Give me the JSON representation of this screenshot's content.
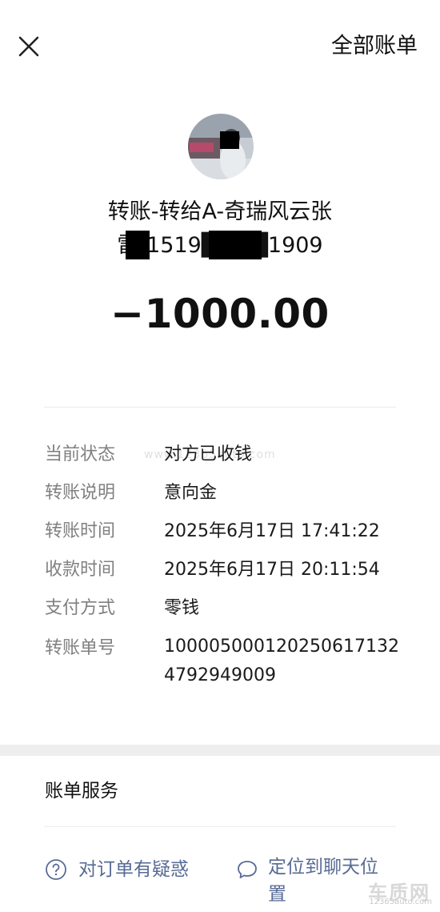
{
  "topbar": {
    "close_icon": "close-icon",
    "all_bills_label": "全部账单"
  },
  "header": {
    "avatar_icon": "avatar",
    "title_line1": "转账-转给A-奇瑞风云张",
    "title_line2": "雷-1519████1909",
    "amount": "−1000.00"
  },
  "details": [
    {
      "label": "当前状态",
      "value": "对方已收钱"
    },
    {
      "label": "转账说明",
      "value": "意向金"
    },
    {
      "label": "转账时间",
      "value": "2025年6月17日 17:41:22"
    },
    {
      "label": "收款时间",
      "value": "2025年6月17日 20:11:54"
    },
    {
      "label": "支付方式",
      "value": "零钱"
    },
    {
      "label": "转账单号",
      "value": "10000500012025061713247929490​09"
    }
  ],
  "watermark_text": "www.12365auto.com",
  "service": {
    "title": "账单服务",
    "help_label": "对订单有疑惑",
    "help_icon": "question-circle-icon",
    "locate_label": "定位到聊天位置",
    "locate_icon": "chat-bubble-icon"
  },
  "brand": {
    "cn": "车质网",
    "en": "12365auto.com"
  },
  "colors": {
    "link": "#576b95",
    "label": "#808080",
    "band": "#eeeeee"
  }
}
